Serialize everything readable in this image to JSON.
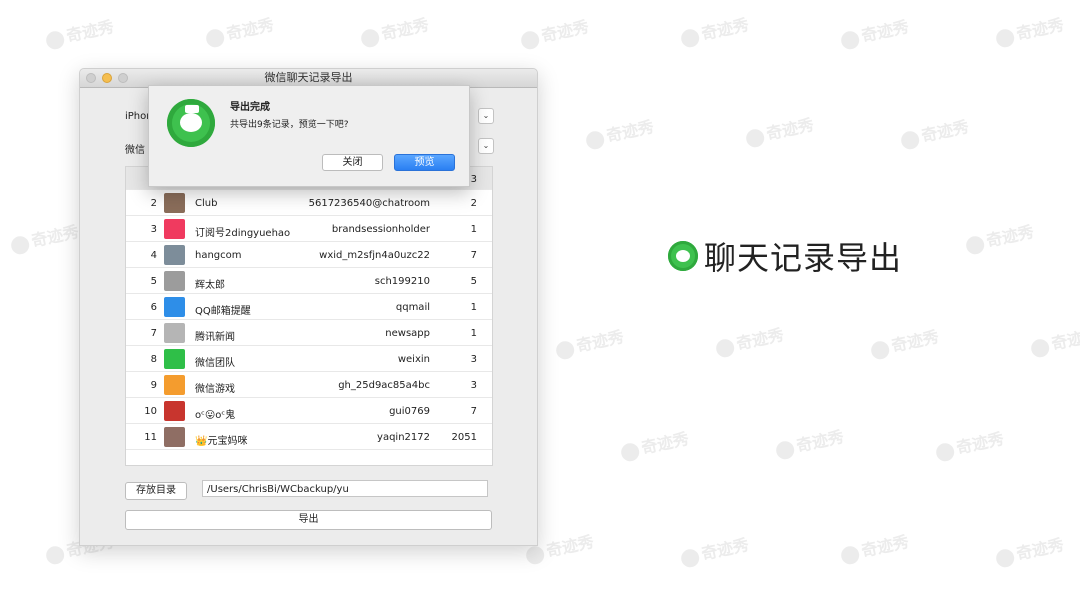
{
  "window": {
    "title": "微信聊天记录导出"
  },
  "labels": {
    "device": "iPhon",
    "wechat": "微信"
  },
  "table": {
    "partial_top_count": "3",
    "rows": [
      {
        "index": "2",
        "name": "Club",
        "id": "5617236540@chatroom",
        "count": "2",
        "avatar_color": "#8a6d5a"
      },
      {
        "index": "3",
        "name": "订阅号2dingyuehao",
        "id": "brandsessionholder",
        "count": "1",
        "avatar_color": "#f03a5f"
      },
      {
        "index": "4",
        "name": "hangcom",
        "id": "wxid_m2sfjn4a0uzc22",
        "count": "7",
        "avatar_color": "#7d8d9a"
      },
      {
        "index": "5",
        "name": "辉太郎",
        "id": "sch199210",
        "count": "5",
        "avatar_color": "#9c9c9c"
      },
      {
        "index": "6",
        "name": "QQ邮箱提醒",
        "id": "qqmail",
        "count": "1",
        "avatar_color": "#2e8ee8"
      },
      {
        "index": "7",
        "name": "腾讯新闻",
        "id": "newsapp",
        "count": "1",
        "avatar_color": "#b5b5b5"
      },
      {
        "index": "8",
        "name": "微信团队",
        "id": "weixin",
        "count": "3",
        "avatar_color": "#2fbf48"
      },
      {
        "index": "9",
        "name": "微信游戏",
        "id": "gh_25d9ac85a4bc",
        "count": "3",
        "avatar_color": "#f49c2e"
      },
      {
        "index": "10",
        "name": "oᶜ😛oᶜ鬼",
        "id": "gui0769",
        "count": "7",
        "avatar_color": "#c8352e"
      },
      {
        "index": "11",
        "name": "👑元宝妈咪",
        "id": "yaqin2172",
        "count": "2051",
        "avatar_color": "#8f6e64"
      }
    ]
  },
  "footer": {
    "folder_button": "存放目录",
    "path": "/Users/ChrisBi/WCbackup/yu",
    "export_button": "导出"
  },
  "dialog": {
    "title": "导出完成",
    "message": "共导出9条记录，预览一下吧?",
    "close_button": "关闭",
    "preview_button": "预览"
  },
  "brand": {
    "text": "聊天记录导出"
  },
  "watermark": {
    "text": "奇迹秀"
  }
}
